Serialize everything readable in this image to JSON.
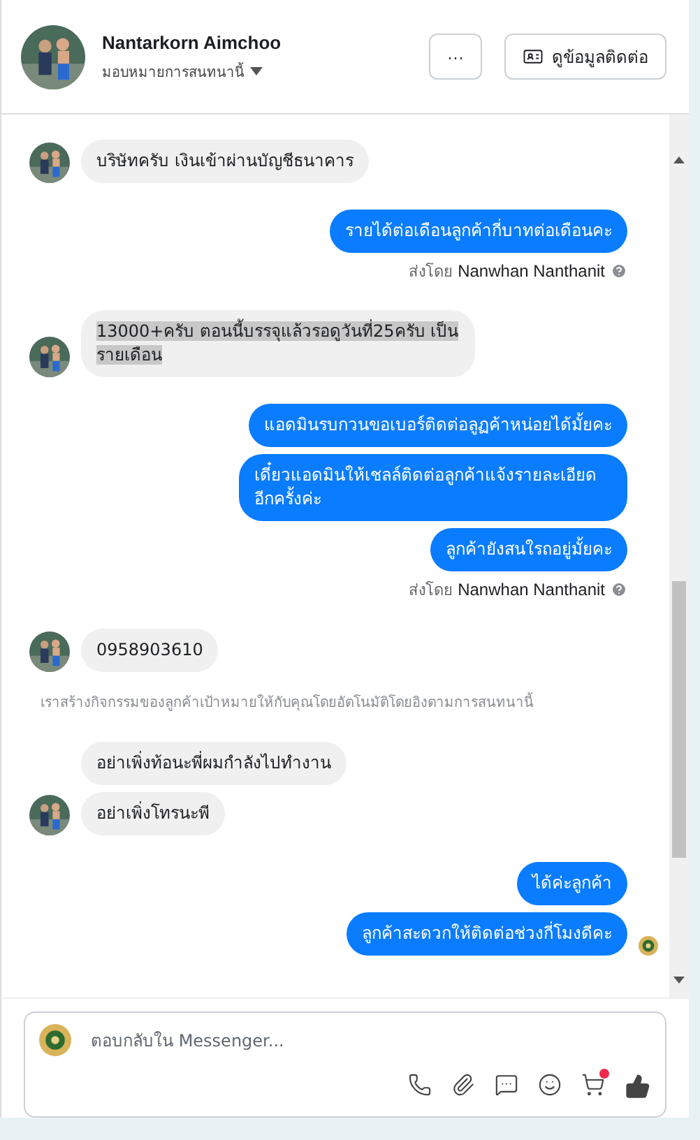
{
  "header": {
    "name": "Nantarkorn Aimchoo",
    "assign_label": "มอบหมายการสนทนานี้",
    "more_button": "···",
    "contact_button": "ดูข้อมูลติดต่อ"
  },
  "messages": [
    {
      "kind": "incoming",
      "text": "บริษัทครับ  เงินเข้าผ่านบัญชีธนาคาร",
      "avatar": true,
      "text_selected": false
    },
    {
      "kind": "outgoing",
      "text": "รายได้ต่อเดือนลูกค้ากี่บาทต่อเดือนคะ",
      "seen": false
    },
    {
      "kind": "sent_by",
      "prefix": "ส่งโดย",
      "name": "Nanwhan Nanthanit"
    },
    {
      "kind": "incoming",
      "text": "13000+ครับ ตอนนี้บรรจุแล้วรอดูวันที่25ครับ เป็นรายเดือน",
      "avatar": true,
      "text_selected": true
    },
    {
      "kind": "outgoing",
      "text": "แอดมินรบกวนขอเบอร์ติดต่อลูฏค้าหน่อยได้มั้ยคะ",
      "seen": false
    },
    {
      "kind": "outgoing",
      "text": "เดี๋ยวแอดมินให้เชลล์ติดต่อลูกค้าแจ้งรายละเอียดอีกครั้งค่ะ",
      "seen": false
    },
    {
      "kind": "outgoing",
      "text": "ลูกค้ายังสนใรถอยู่มั้ยคะ",
      "seen": false
    },
    {
      "kind": "sent_by",
      "prefix": "ส่งโดย",
      "name": "Nanwhan Nanthanit"
    },
    {
      "kind": "incoming",
      "text": "0958903610",
      "avatar": true,
      "text_selected": false
    },
    {
      "kind": "notice",
      "text": "เราสร้างกิจกรรมของลูกค้าเป้าหมายให้กับคุณโดยอัตโนมัติโดยอิงตามการสนทนานี้"
    },
    {
      "kind": "incoming",
      "text": "อย่าเพิ่งท้อนะพี่ผมกำลังไปทำงาน",
      "avatar": false,
      "text_selected": false
    },
    {
      "kind": "incoming",
      "text": "อย่าเพิ่งโทรนะพี",
      "avatar": true,
      "text_selected": false
    },
    {
      "kind": "outgoing",
      "text": "ได้ค่ะลูกค้า",
      "seen": false
    },
    {
      "kind": "outgoing",
      "text": "ลูกค้าสะดวกให้ติดต่อช่วงกี่โมงดีคะ",
      "seen": true
    }
  ],
  "composer": {
    "placeholder": "ตอบกลับใน Messenger...",
    "cart_notification": true
  }
}
